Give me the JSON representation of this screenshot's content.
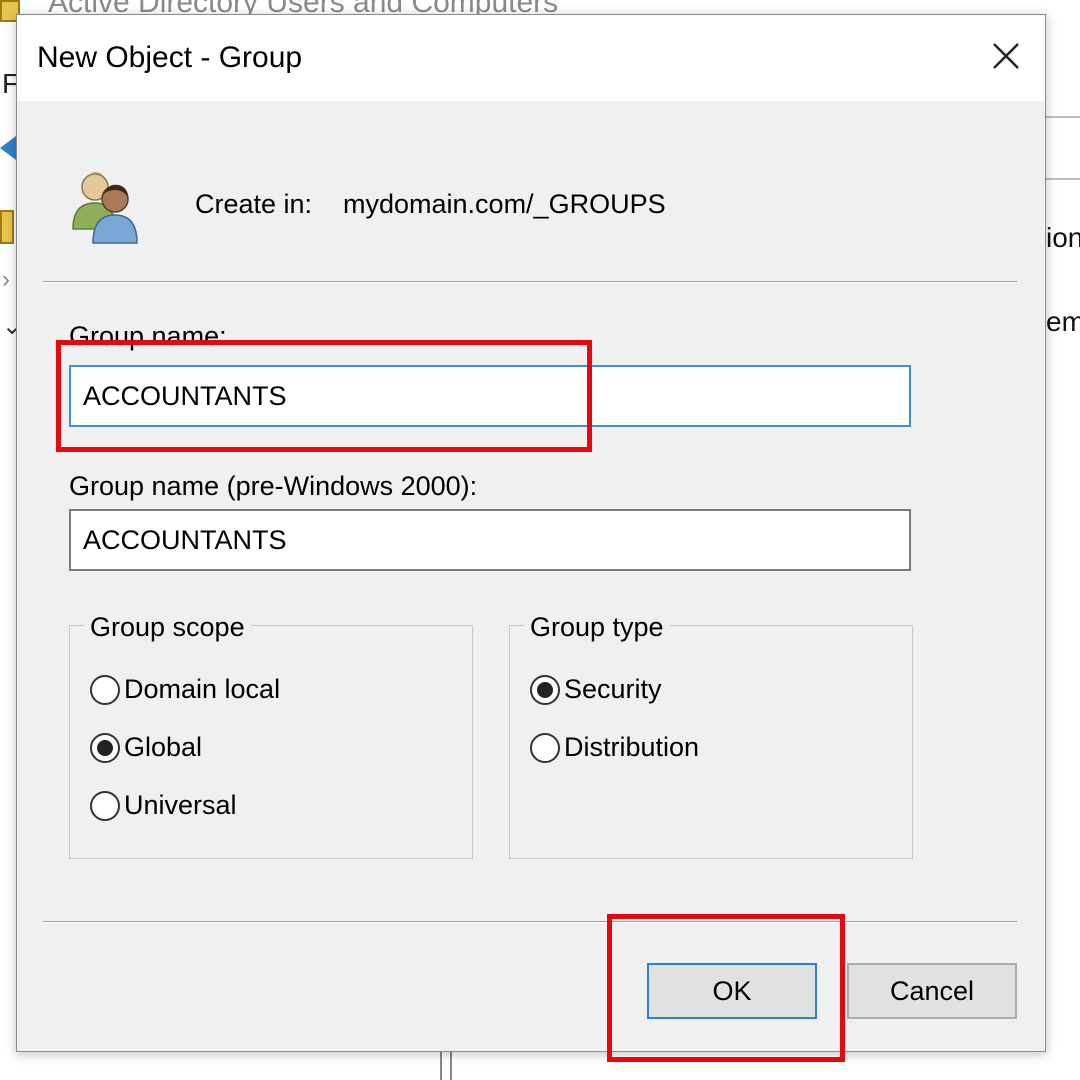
{
  "background_window": {
    "title": "Active Directory Users and Computers",
    "menu_letter": "F",
    "right_text_1": "ion",
    "right_text_2": "ems"
  },
  "dialog": {
    "title": "New Object - Group",
    "close_glyph": "✕",
    "create_in_label": "Create in:",
    "create_in_value": "mydomain.com/_GROUPS",
    "group_name_label": "Group name:",
    "group_name_value": "ACCOUNTANTS",
    "prewin_label": "Group name (pre-Windows 2000):",
    "prewin_value": "ACCOUNTANTS",
    "group_scope": {
      "legend": "Group scope",
      "options": [
        {
          "label": "Domain local",
          "selected": false
        },
        {
          "label": "Global",
          "selected": true
        },
        {
          "label": "Universal",
          "selected": false
        }
      ]
    },
    "group_type": {
      "legend": "Group type",
      "options": [
        {
          "label": "Security",
          "selected": true
        },
        {
          "label": "Distribution",
          "selected": false
        }
      ]
    },
    "ok_label": "OK",
    "cancel_label": "Cancel"
  },
  "colors": {
    "highlight": "#e5090f",
    "focus_border": "#3a8fe0",
    "dialog_background": "#f0f0f0"
  },
  "icons": {
    "dialog": "group-icon",
    "close": "close-icon"
  }
}
